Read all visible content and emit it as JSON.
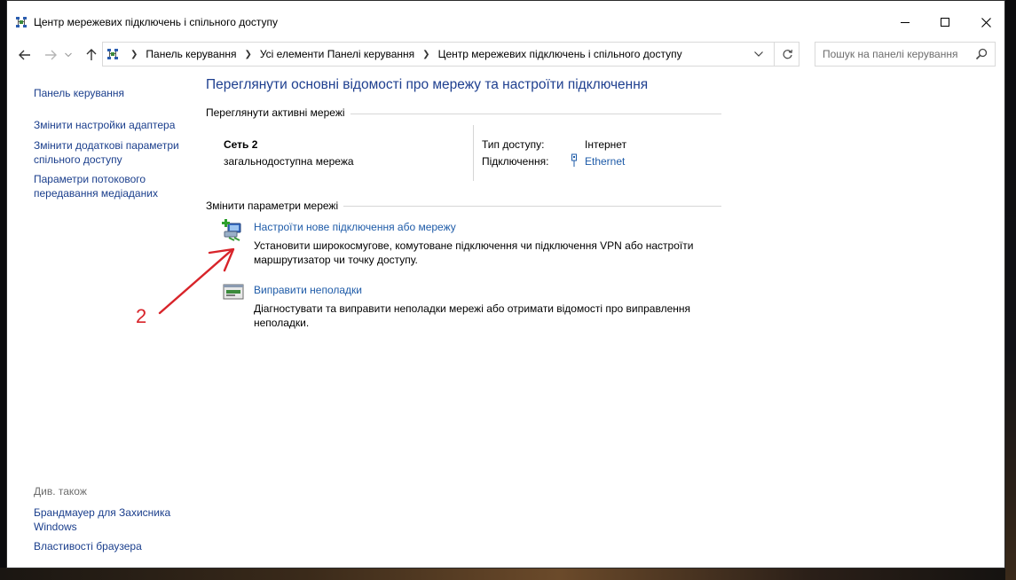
{
  "window": {
    "title": "Центр мережевих підключень і спільного доступу",
    "controls": {
      "minimize": "—",
      "maximize": "☐",
      "close": "✕"
    }
  },
  "address": {
    "crumbs": [
      "Панель керування",
      "Усі елементи Панелі керування",
      "Центр мережевих підключень і спільного доступу"
    ]
  },
  "search": {
    "placeholder": "Пошук на панелі керування"
  },
  "sidebar": {
    "home": "Панель керування",
    "items": [
      "Змінити настройки адаптера",
      "Змінити додаткові параметри спільного доступу",
      "Параметри потокового передавання медіаданих"
    ],
    "see_also_label": "Див. також",
    "see_also": [
      "Брандмауер для Захисника Windows",
      "Властивості браузера"
    ]
  },
  "main": {
    "title": "Переглянути основні відомості про мережу та настроїти підключення",
    "active_networks": {
      "label": "Переглянути активні мережі",
      "network_name": "Сеть 2",
      "network_type": "загальнодоступна мережа",
      "access_type_label": "Тип доступу:",
      "access_type_value": "Інтернет",
      "connections_label": "Підключення:",
      "connections_value": "Ethernet"
    },
    "change_settings": {
      "label": "Змінити параметри мережі",
      "items": [
        {
          "link": "Настроїти нове підключення або мережу",
          "description": "Установити широкосмугове, комутоване підключення чи підключення VPN або настроїти маршрутизатор чи точку доступу.",
          "icon": "new-connection-icon"
        },
        {
          "link": "Виправити неполадки",
          "description": "Діагностувати та виправити неполадки мережі або отримати відомості про виправлення неполадки.",
          "icon": "troubleshoot-icon"
        }
      ]
    }
  },
  "annotation": {
    "number": "2"
  },
  "colors": {
    "link": "#1e5ba8",
    "title": "#1e3f8f",
    "annotation": "#d8242a"
  }
}
